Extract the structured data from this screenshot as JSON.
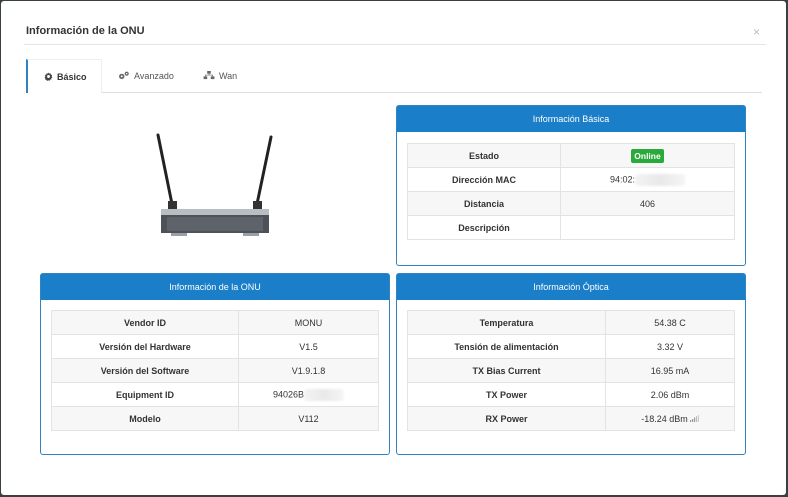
{
  "modal": {
    "title": "Información de la ONU",
    "close": "×"
  },
  "tabs": [
    {
      "label": "Básico",
      "icon": "gear-icon",
      "active": true
    },
    {
      "label": "Avanzado",
      "icon": "gears-icon",
      "active": false
    },
    {
      "label": "Wan",
      "icon": "sitemap-icon",
      "active": false
    }
  ],
  "basic_info": {
    "title": "Información Básica",
    "rows": [
      {
        "label": "Estado",
        "value": "Online"
      },
      {
        "label": "Dirección MAC",
        "value": "94:02:"
      },
      {
        "label": "Distancia",
        "value": "406"
      },
      {
        "label": "Descripción",
        "value": ""
      }
    ]
  },
  "onu_info": {
    "title": "Información de la ONU",
    "rows": [
      {
        "label": "Vendor ID",
        "value": "MONU"
      },
      {
        "label": "Versión del Hardware",
        "value": "V1.5"
      },
      {
        "label": "Versión del Software",
        "value": "V1.9.1.8"
      },
      {
        "label": "Equipment ID",
        "value": "94026B"
      },
      {
        "label": "Modelo",
        "value": "V112"
      }
    ]
  },
  "optical_info": {
    "title": "Información Óptica",
    "rows": [
      {
        "label": "Temperatura",
        "value": "54.38 C"
      },
      {
        "label": "Tensión de alimentación",
        "value": "3.32 V"
      },
      {
        "label": "TX Bias Current",
        "value": "16.95 mA"
      },
      {
        "label": "TX Power",
        "value": "2.06 dBm"
      },
      {
        "label": "RX Power",
        "value": "-18.24 dBm"
      }
    ]
  },
  "colors": {
    "accent": "#1b7ec8",
    "online": "#2aaa3a"
  }
}
